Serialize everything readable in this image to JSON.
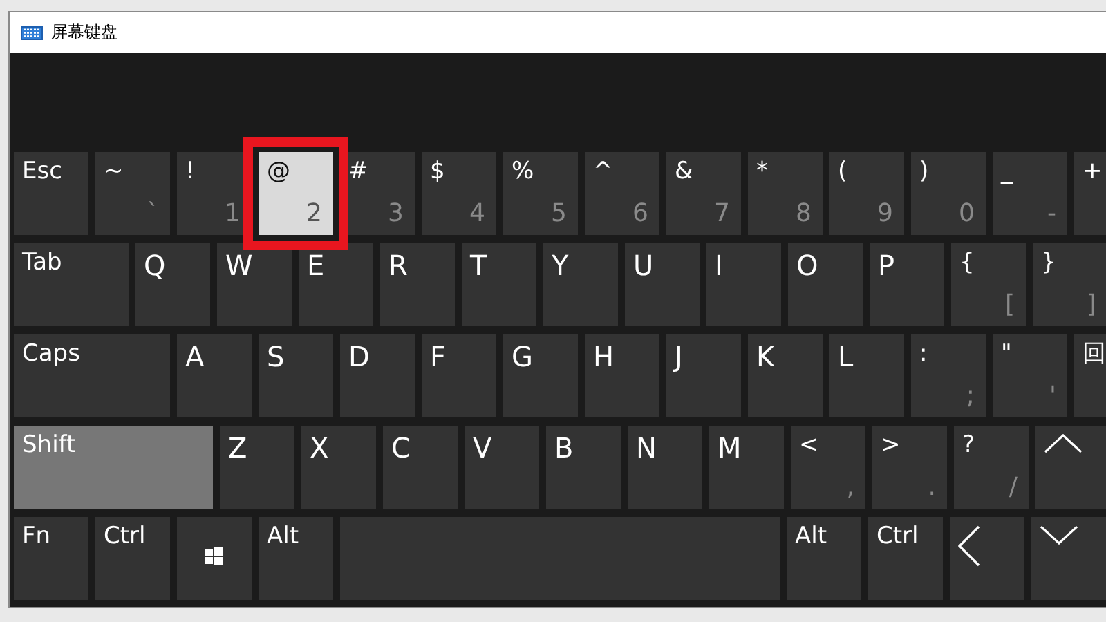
{
  "window": {
    "title": "屏幕键盘"
  },
  "keyboard": {
    "rows": [
      {
        "keys": [
          {
            "kind": "mod",
            "label": "Esc",
            "pressed": false,
            "latched": false,
            "outlined": false
          },
          {
            "kind": "char",
            "label": "~",
            "sub": "`",
            "pressed": false,
            "latched": false,
            "outlined": false
          },
          {
            "kind": "char",
            "label": "!",
            "sub": "1",
            "pressed": false,
            "latched": false,
            "outlined": false
          },
          {
            "kind": "char",
            "label": "@",
            "sub": "2",
            "pressed": true,
            "latched": false,
            "outlined": true
          },
          {
            "kind": "char",
            "label": "#",
            "sub": "3",
            "pressed": false,
            "latched": false,
            "outlined": false
          },
          {
            "kind": "char",
            "label": "$",
            "sub": "4",
            "pressed": false,
            "latched": false,
            "outlined": false
          },
          {
            "kind": "char",
            "label": "%",
            "sub": "5",
            "pressed": false,
            "latched": false,
            "outlined": false
          },
          {
            "kind": "char",
            "label": "^",
            "sub": "6",
            "pressed": false,
            "latched": false,
            "outlined": false
          },
          {
            "kind": "char",
            "label": "&",
            "sub": "7",
            "pressed": false,
            "latched": false,
            "outlined": false
          },
          {
            "kind": "char",
            "label": "*",
            "sub": "8",
            "pressed": false,
            "latched": false,
            "outlined": false
          },
          {
            "kind": "char",
            "label": "(",
            "sub": "9",
            "pressed": false,
            "latched": false,
            "outlined": false
          },
          {
            "kind": "char",
            "label": ")",
            "sub": "0",
            "pressed": false,
            "latched": false,
            "outlined": false
          },
          {
            "kind": "char",
            "label": "_",
            "sub": "-",
            "pressed": false,
            "latched": false,
            "outlined": false
          },
          {
            "kind": "char",
            "label": "+",
            "pressed": false,
            "latched": false,
            "outlined": false
          }
        ]
      },
      {
        "keys": [
          {
            "kind": "tab",
            "label": "Tab",
            "pressed": false,
            "latched": false,
            "outlined": false
          },
          {
            "kind": "letter",
            "label": "Q",
            "pressed": false,
            "latched": false,
            "outlined": false
          },
          {
            "kind": "letter",
            "label": "W",
            "pressed": false,
            "latched": false,
            "outlined": false
          },
          {
            "kind": "letter",
            "label": "E",
            "pressed": false,
            "latched": false,
            "outlined": false
          },
          {
            "kind": "letter",
            "label": "R",
            "pressed": false,
            "latched": false,
            "outlined": false
          },
          {
            "kind": "letter",
            "label": "T",
            "pressed": false,
            "latched": false,
            "outlined": false
          },
          {
            "kind": "letter",
            "label": "Y",
            "pressed": false,
            "latched": false,
            "outlined": false
          },
          {
            "kind": "letter",
            "label": "U",
            "pressed": false,
            "latched": false,
            "outlined": false
          },
          {
            "kind": "letter",
            "label": "I",
            "pressed": false,
            "latched": false,
            "outlined": false
          },
          {
            "kind": "letter",
            "label": "O",
            "pressed": false,
            "latched": false,
            "outlined": false
          },
          {
            "kind": "letter",
            "label": "P",
            "pressed": false,
            "latched": false,
            "outlined": false
          },
          {
            "kind": "char",
            "label": "{",
            "sub": "[",
            "pressed": false,
            "latched": false,
            "outlined": false
          },
          {
            "kind": "char",
            "label": "}",
            "sub": "]",
            "pressed": false,
            "latched": false,
            "outlined": false
          }
        ]
      },
      {
        "keys": [
          {
            "kind": "caps",
            "label": "Caps",
            "pressed": false,
            "latched": false,
            "outlined": false
          },
          {
            "kind": "letter",
            "label": "A",
            "pressed": false,
            "latched": false,
            "outlined": false
          },
          {
            "kind": "letter",
            "label": "S",
            "pressed": false,
            "latched": false,
            "outlined": false
          },
          {
            "kind": "letter",
            "label": "D",
            "pressed": false,
            "latched": false,
            "outlined": false
          },
          {
            "kind": "letter",
            "label": "F",
            "pressed": false,
            "latched": false,
            "outlined": false
          },
          {
            "kind": "letter",
            "label": "G",
            "pressed": false,
            "latched": false,
            "outlined": false
          },
          {
            "kind": "letter",
            "label": "H",
            "pressed": false,
            "latched": false,
            "outlined": false
          },
          {
            "kind": "letter",
            "label": "J",
            "pressed": false,
            "latched": false,
            "outlined": false
          },
          {
            "kind": "letter",
            "label": "K",
            "pressed": false,
            "latched": false,
            "outlined": false
          },
          {
            "kind": "letter",
            "label": "L",
            "pressed": false,
            "latched": false,
            "outlined": false
          },
          {
            "kind": "char",
            "label": ":",
            "sub": ";",
            "pressed": false,
            "latched": false,
            "outlined": false
          },
          {
            "kind": "char",
            "label": "\"",
            "sub": "'",
            "pressed": false,
            "latched": false,
            "outlined": false
          },
          {
            "kind": "char",
            "label": "回",
            "pressed": false,
            "latched": false,
            "outlined": false
          }
        ]
      },
      {
        "keys": [
          {
            "kind": "shift",
            "label": "Shift",
            "pressed": false,
            "latched": true,
            "outlined": false
          },
          {
            "kind": "letter",
            "label": "Z",
            "pressed": false,
            "latched": false,
            "outlined": false
          },
          {
            "kind": "letter",
            "label": "X",
            "pressed": false,
            "latched": false,
            "outlined": false
          },
          {
            "kind": "letter",
            "label": "C",
            "pressed": false,
            "latched": false,
            "outlined": false
          },
          {
            "kind": "letter",
            "label": "V",
            "pressed": false,
            "latched": false,
            "outlined": false
          },
          {
            "kind": "letter",
            "label": "B",
            "pressed": false,
            "latched": false,
            "outlined": false
          },
          {
            "kind": "letter",
            "label": "N",
            "pressed": false,
            "latched": false,
            "outlined": false
          },
          {
            "kind": "letter",
            "label": "M",
            "pressed": false,
            "latched": false,
            "outlined": false
          },
          {
            "kind": "char",
            "label": "<",
            "sub": ",",
            "pressed": false,
            "latched": false,
            "outlined": false
          },
          {
            "kind": "char",
            "label": ">",
            "sub": ".",
            "pressed": false,
            "latched": false,
            "outlined": false
          },
          {
            "kind": "char",
            "label": "?",
            "sub": "/",
            "pressed": false,
            "latched": false,
            "outlined": false
          },
          {
            "kind": "up",
            "pressed": false,
            "latched": false,
            "outlined": false
          }
        ]
      },
      {
        "keys": [
          {
            "kind": "mod",
            "label": "Fn",
            "pressed": false,
            "latched": false,
            "outlined": false
          },
          {
            "kind": "mod",
            "label": "Ctrl",
            "pressed": false,
            "latched": false,
            "outlined": false
          },
          {
            "kind": "windows",
            "pressed": false,
            "latched": false,
            "outlined": false
          },
          {
            "kind": "mod",
            "label": "Alt",
            "pressed": false,
            "latched": false,
            "outlined": false
          },
          {
            "kind": "space",
            "pressed": false,
            "latched": false,
            "outlined": false
          },
          {
            "kind": "mod",
            "label": "Alt",
            "pressed": false,
            "latched": false,
            "outlined": false
          },
          {
            "kind": "mod",
            "label": "Ctrl",
            "pressed": false,
            "latched": false,
            "outlined": false
          },
          {
            "kind": "left",
            "pressed": false,
            "latched": false,
            "outlined": false
          },
          {
            "kind": "down",
            "pressed": false,
            "latched": false,
            "outlined": false
          }
        ]
      }
    ]
  }
}
